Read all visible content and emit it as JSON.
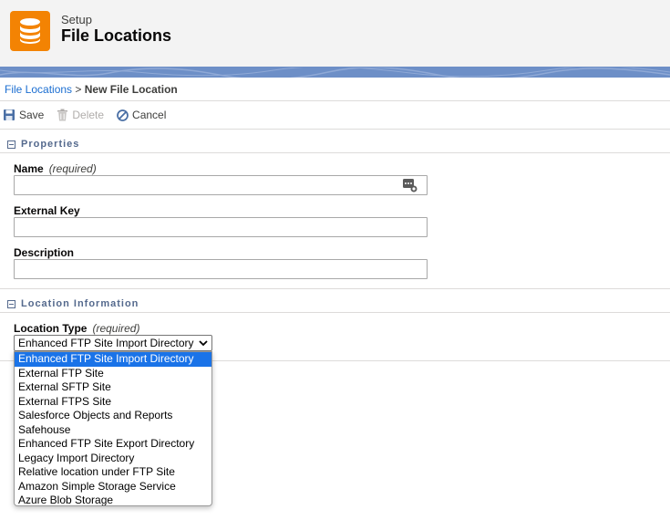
{
  "header": {
    "eyebrow": "Setup",
    "title": "File Locations",
    "icon": "database-icon",
    "icon_color": "#f38303"
  },
  "breadcrumb": {
    "link": "File Locations",
    "separator": ">",
    "current": "New File Location"
  },
  "toolbar": {
    "save_label": "Save",
    "delete_label": "Delete",
    "cancel_label": "Cancel"
  },
  "sections": {
    "properties": "Properties",
    "location_info": "Location Information"
  },
  "fields": {
    "name_label": "Name",
    "name_required": "(required)",
    "name_value": "",
    "external_key_label": "External Key",
    "external_key_value": "",
    "description_label": "Description",
    "description_value": "",
    "location_type_label": "Location Type",
    "location_type_required": "(required)",
    "location_type_value": "Enhanced FTP Site Import Directory"
  },
  "location_type_options": [
    "Enhanced FTP Site Import Directory",
    "External FTP Site",
    "External SFTP Site",
    "External FTPS Site",
    "Salesforce Objects and Reports",
    "Safehouse",
    "Enhanced FTP Site Export Directory",
    "Legacy Import Directory",
    "Relative location under FTP Site",
    "Amazon Simple Storage Service",
    "Azure Blob Storage"
  ],
  "colors": {
    "accent": "#1b6ed1",
    "selected_option": "#1a73e8",
    "banner": "#6d8fc7"
  }
}
